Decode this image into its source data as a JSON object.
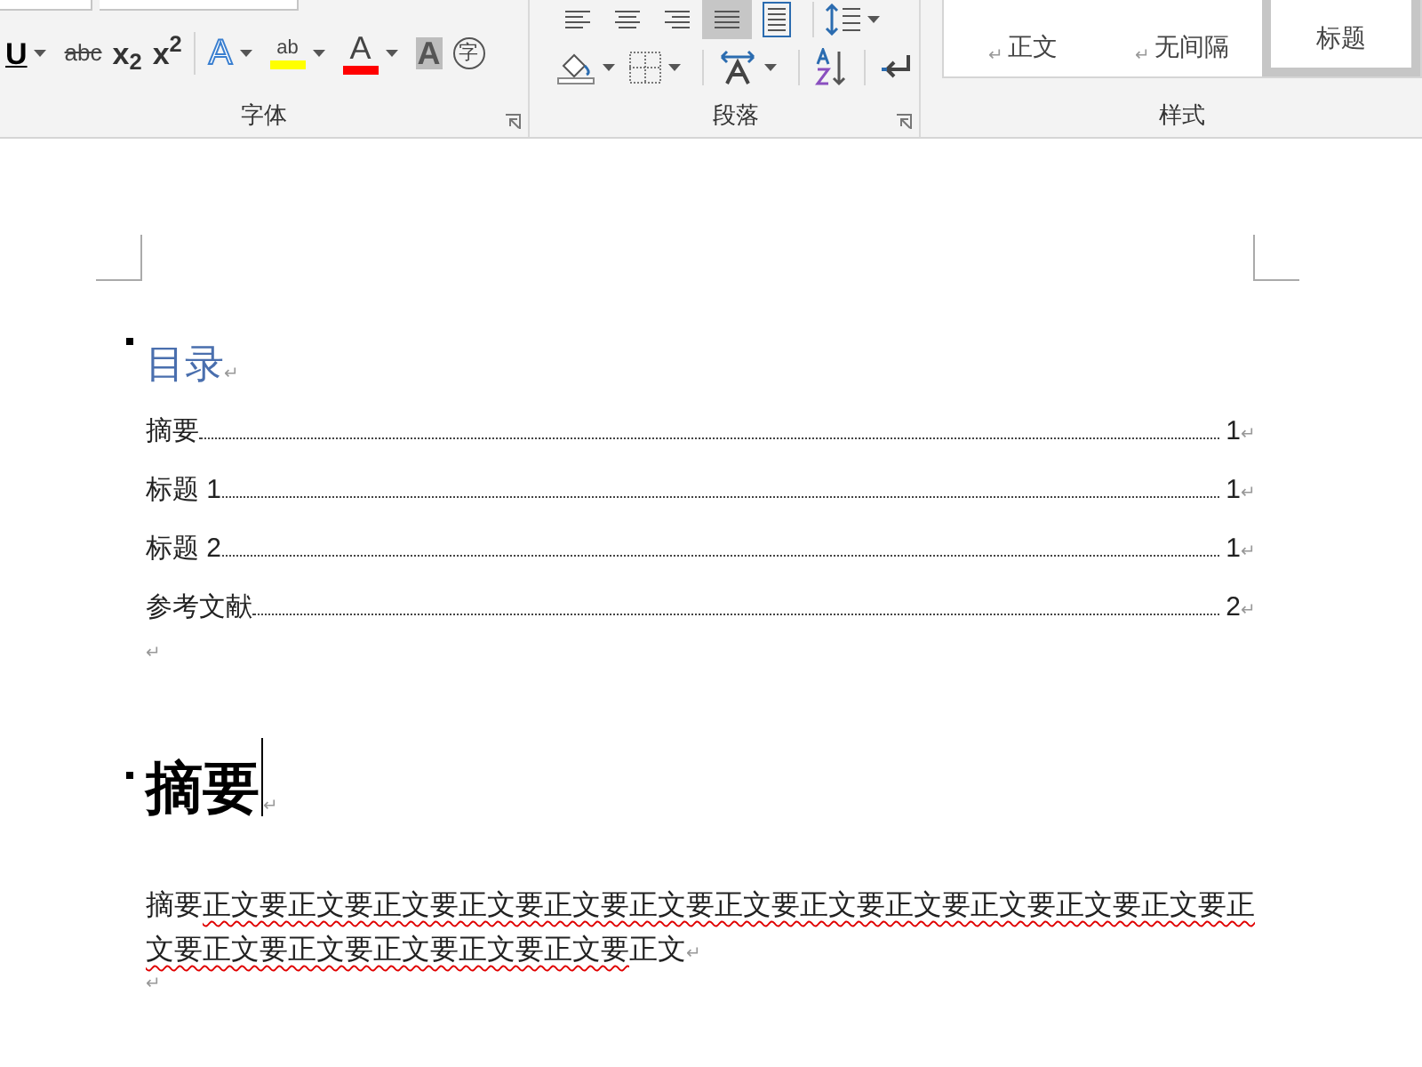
{
  "ribbon": {
    "font_group": {
      "label": "字体",
      "buttons": [
        {
          "kind": "underline",
          "text": "U",
          "dropdown": true
        },
        {
          "kind": "strike",
          "text": "abc",
          "dropdown": false
        },
        {
          "kind": "plain",
          "text": "x$_{2}$",
          "dropdown": false
        },
        {
          "kind": "plain",
          "text": "x$^{2}$",
          "dropdown": false
        },
        {
          "kind": "effects",
          "text": "A",
          "dropdown": true
        },
        {
          "kind": "highlight",
          "text": "ab",
          "color": "#ffff00",
          "dropdown": true
        },
        {
          "kind": "fontcolor",
          "text": "A",
          "color": "#ff0000",
          "dropdown": true
        },
        {
          "kind": "shaded",
          "text": "A",
          "dropdown": false
        },
        {
          "kind": "circled",
          "text": "字",
          "dropdown": false
        }
      ]
    },
    "paragraph_group": {
      "label": "段落",
      "row1": [
        {
          "kind": "align-left",
          "selected": false
        },
        {
          "kind": "align-center",
          "selected": false
        },
        {
          "kind": "align-right",
          "selected": false
        },
        {
          "kind": "justify",
          "selected": true
        },
        {
          "kind": "distribute",
          "selected": false
        },
        {
          "kind": "line-spacing",
          "selected": false,
          "dropdown": true
        }
      ],
      "row2": [
        {
          "kind": "shading",
          "dropdown": true
        },
        {
          "kind": "borders",
          "dropdown": true
        },
        {
          "kind": "text-direction",
          "dropdown": true
        },
        {
          "kind": "sort",
          "dropdown": false
        },
        {
          "kind": "return",
          "dropdown": false
        }
      ]
    },
    "styles_group": {
      "label": "样式",
      "items": [
        {
          "mark": "↵",
          "label": "正文",
          "selected": false
        },
        {
          "mark": "↵",
          "label": "无间隔",
          "selected": false
        },
        {
          "label": "标题",
          "selected": true
        }
      ]
    }
  },
  "document": {
    "toc_title": {
      "text": "目录",
      "mark": "↵"
    },
    "toc": [
      {
        "title": "摘要",
        "page": "1",
        "mark": "↵"
      },
      {
        "title": "标题 1",
        "page": "1",
        "mark": "↵"
      },
      {
        "title": "标题 2",
        "page": "1",
        "mark": "↵"
      },
      {
        "title": "参考文献",
        "page": "2",
        "mark": "↵"
      }
    ],
    "empty_mark_1": "↵",
    "heading": {
      "text": "摘要",
      "mark": "↵"
    },
    "body": {
      "segments": [
        {
          "text": "摘要",
          "misspelled": false
        },
        {
          "text": "正文要正文要正文要正文要正文要正文要正文要正文要正文要正文要正文要正文要正文要正文要正文要正文要正文要正文要",
          "misspelled": true
        },
        {
          "text": "正文",
          "misspelled": false
        }
      ],
      "mark": "↵"
    },
    "empty_mark_2": "↵"
  }
}
